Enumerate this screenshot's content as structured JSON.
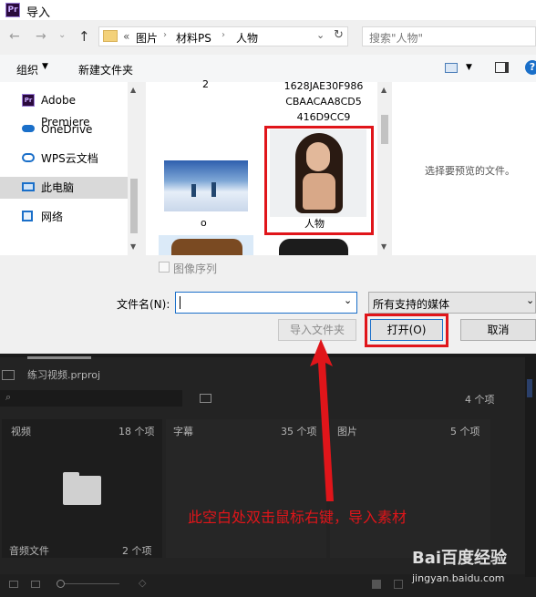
{
  "title_bar": {
    "title": "导入",
    "app_icon_text": "Pr"
  },
  "nav": {
    "back_icon": "arrow-left-icon",
    "forward_icon": "arrow-right-icon",
    "path_prefix": "«",
    "path": [
      "图片",
      "材料PS",
      "人物"
    ],
    "search_placeholder": "搜索\"人物\""
  },
  "toolbar": {
    "organize": "组织",
    "new_folder": "新建文件夹"
  },
  "sidebar": {
    "items": [
      {
        "label": "Adobe Premiere",
        "icon": "premiere-icon"
      },
      {
        "label": "OneDrive",
        "icon": "cloud-icon"
      },
      {
        "label": "WPS云文档",
        "icon": "wps-cloud-icon"
      },
      {
        "label": "此电脑",
        "icon": "computer-icon"
      },
      {
        "label": "网络",
        "icon": "network-icon"
      }
    ]
  },
  "files": {
    "top_left_name": "2",
    "top_right_name_lines": [
      "1628JAE30F986",
      "CBAACAA8CD5",
      "416D9CC9"
    ],
    "items": [
      {
        "name": "o"
      },
      {
        "name": "人物"
      }
    ]
  },
  "preview": {
    "text": "选择要预览的文件。"
  },
  "options": {
    "image_sequence": "图像序列"
  },
  "filename": {
    "label": "文件名(N):",
    "value": "",
    "filter": "所有支持的媒体"
  },
  "buttons": {
    "import_folder": "导入文件夹",
    "open": "打开(O)",
    "cancel": "取消"
  },
  "premiere": {
    "project_file": "练习视频.prproj",
    "item_count": "4 个项",
    "bins": [
      {
        "name": "视频",
        "count": "18 个项"
      },
      {
        "name": "字幕",
        "count": "35 个项"
      },
      {
        "name": "图片",
        "count": "5 个项"
      },
      {
        "name": "音频文件",
        "count": "2 个项"
      }
    ]
  },
  "annotation": {
    "text": "此空白处双击鼠标右键，导入素材"
  },
  "watermark": {
    "brand": "Bai百度经验",
    "url": "jingyan.baidu.com"
  },
  "colors": {
    "annotation_red": "#e0151a",
    "premiere_bg": "#232323",
    "selection": "#cce8ff"
  }
}
